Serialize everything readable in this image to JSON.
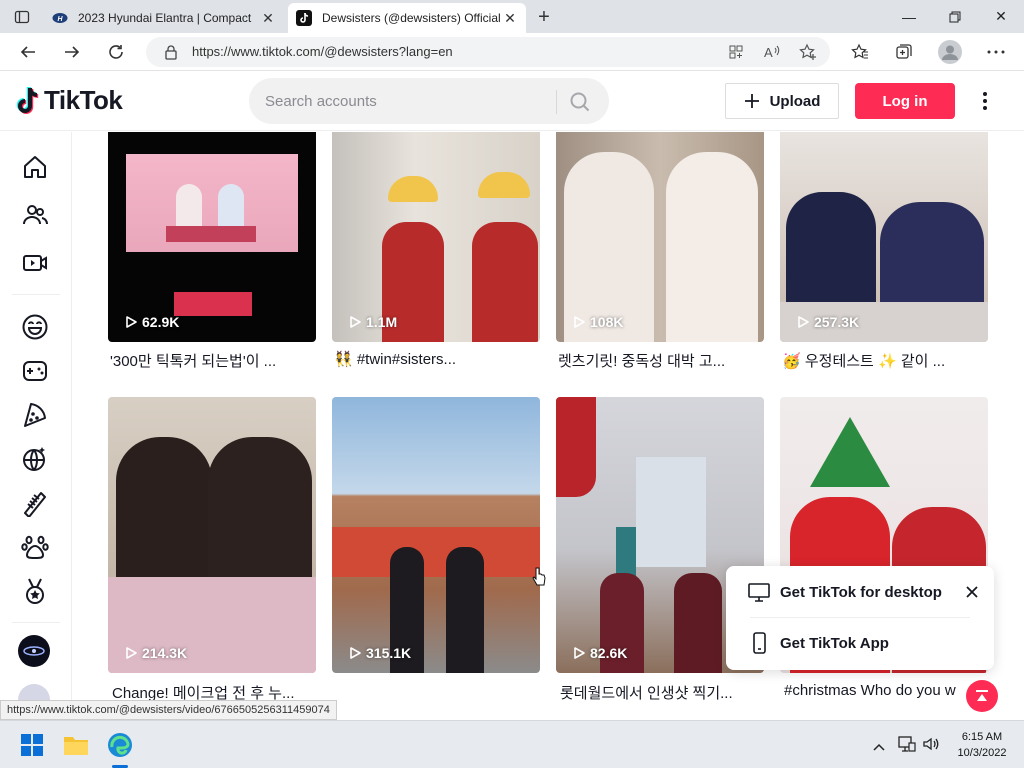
{
  "browser": {
    "tabs": [
      {
        "title": "2023 Hyundai Elantra | Compact",
        "active": false
      },
      {
        "title": "Dewsisters (@dewsisters) Official",
        "active": true
      }
    ],
    "url": "https://www.tiktok.com/@dewsisters?lang=en",
    "status_url": "https://www.tiktok.com/@dewsisters/video/6766505256311459074"
  },
  "tiktok": {
    "logo_text": "TikTok",
    "search_placeholder": "Search accounts",
    "upload_label": "Upload",
    "login_label": "Log in",
    "accent": "#fe2c55"
  },
  "sidebar": {
    "items": [
      "home-icon",
      "following-icon",
      "live-icon",
      "smile-icon",
      "gamepad-icon",
      "food-icon",
      "globe-icon",
      "comb-icon",
      "paw-icon",
      "medal-icon"
    ]
  },
  "videos": [
    {
      "views": "62.9K",
      "caption": "'300만 틱톡커 되는법'이 ...",
      "tags": ""
    },
    {
      "views": "1.1M",
      "caption": "👯 #twin#sisters...",
      "tags": ""
    },
    {
      "views": "108K",
      "caption": "렛츠기릿! 중독성 대박 고...",
      "tags": ""
    },
    {
      "views": "257.3K",
      "caption": "🥳 우정테스트 ✨ 같이 ...",
      "tags": ""
    },
    {
      "views": "214.3K",
      "caption": "Change! 메이크업 전 후 누...",
      "tags": ""
    },
    {
      "views": "315.1K",
      "caption": "",
      "tags": ""
    },
    {
      "views": "82.6K",
      "caption": "롯데월드에서 인생샷 찍기...",
      "tags": ""
    },
    {
      "views": "",
      "caption": "#christmas Who do you w",
      "tags": ""
    }
  ],
  "popup": {
    "desktop_label": "Get TikTok for desktop",
    "app_label": "Get TikTok App"
  },
  "taskbar": {
    "time": "6:15 AM",
    "date": "10/3/2022"
  }
}
